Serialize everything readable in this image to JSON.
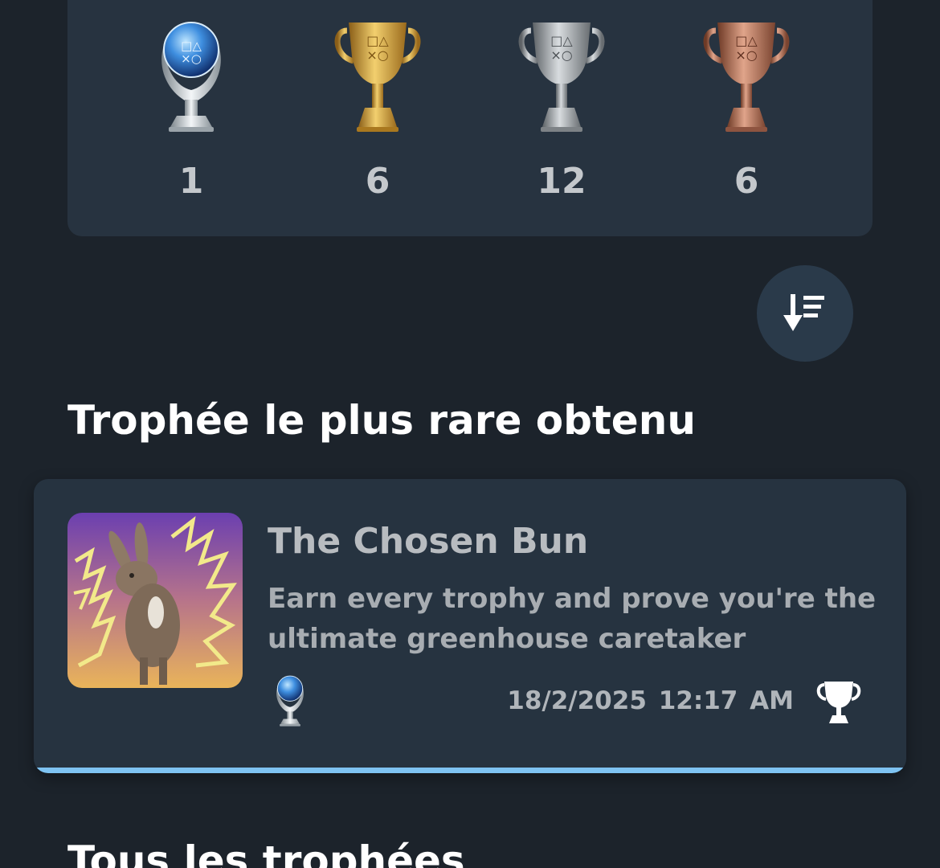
{
  "trophy_summary": {
    "platinum": {
      "count": "1",
      "icon": "platinum-trophy-icon"
    },
    "gold": {
      "count": "6",
      "icon": "gold-trophy-icon"
    },
    "silver": {
      "count": "12",
      "icon": "silver-trophy-icon"
    },
    "bronze": {
      "count": "6",
      "icon": "bronze-trophy-icon"
    }
  },
  "sort_button": {
    "icon": "sort-descending-icon"
  },
  "rarest_section": {
    "title": "Trophée le plus rare obtenu",
    "trophy": {
      "name": "The Chosen Bun",
      "description": "Earn every trophy and prove you're the ultimate greenhouse caretaker",
      "grade_icon": "platinum-trophy-icon",
      "earned_date": "18/2/2025",
      "earned_time": "12:17 AM",
      "earned_icon": "trophy-icon",
      "progress": 1.0
    }
  },
  "all_section": {
    "title": "Tous les trophées"
  },
  "colors": {
    "background": "#1c232b",
    "card": "#273340",
    "accent": "#7ec3f2"
  }
}
